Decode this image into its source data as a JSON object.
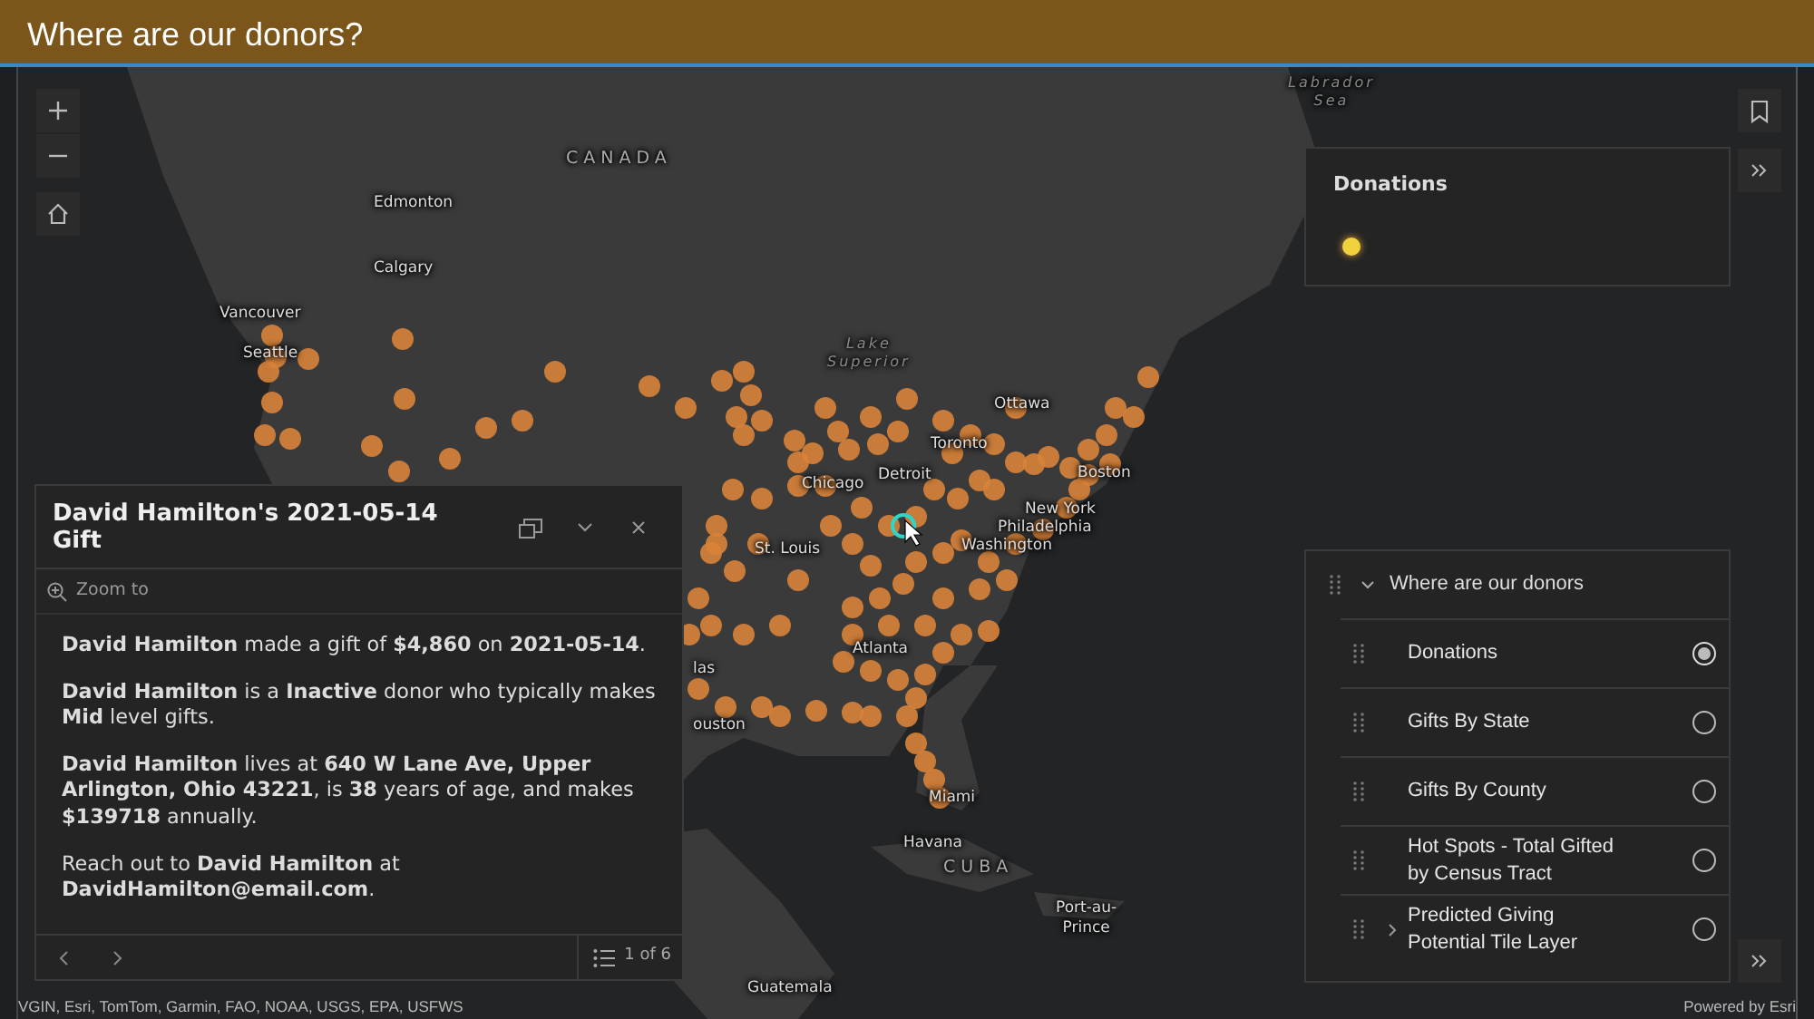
{
  "header": {
    "title": "Where are our donors?"
  },
  "map": {
    "labels": [
      {
        "text": "CANADA",
        "kind": "country"
      },
      {
        "text": "Edmonton",
        "kind": "city"
      },
      {
        "text": "Calgary",
        "kind": "city"
      },
      {
        "text": "Vancouver",
        "kind": "city"
      },
      {
        "text": "Seattle",
        "kind": "city"
      },
      {
        "text": "Lake\nSuperior",
        "kind": "water"
      },
      {
        "text": "Labrador\nSea",
        "kind": "water"
      },
      {
        "text": "Ottawa",
        "kind": "city"
      },
      {
        "text": "Toronto",
        "kind": "city"
      },
      {
        "text": "Chicago",
        "kind": "city"
      },
      {
        "text": "Detroit",
        "kind": "city"
      },
      {
        "text": "Boston",
        "kind": "city"
      },
      {
        "text": "New York",
        "kind": "city"
      },
      {
        "text": "Philadelphia",
        "kind": "city"
      },
      {
        "text": "St. Louis",
        "kind": "city"
      },
      {
        "text": "Washington",
        "kind": "city"
      },
      {
        "text": "las",
        "kind": "city"
      },
      {
        "text": "Atlanta",
        "kind": "city"
      },
      {
        "text": "ouston",
        "kind": "city"
      },
      {
        "text": "Miami",
        "kind": "city"
      },
      {
        "text": "Havana",
        "kind": "city"
      },
      {
        "text": "CUBA",
        "kind": "country"
      },
      {
        "text": "Port-au-\nPrince",
        "kind": "city"
      },
      {
        "text": "Guatemala",
        "kind": "city"
      }
    ],
    "attribution": "VGIN, Esri, TomTom, Garmin, FAO, NOAA, USGS, EPA, USFWS",
    "powered_by": "Powered by Esri"
  },
  "popup": {
    "title": "David Hamilton's 2021-05-14 Gift",
    "action": "Zoom to",
    "paragraphs": [
      "**David Hamilton** made a gift of **$4,860** on **2021-05-14**.",
      "**David Hamilton** is a **Inactive** donor who typically makes **Mid** level gifts.",
      "**David Hamilton** lives at **640 W Lane Ave, Upper Arlington, Ohio 43221**, is **38** years of age, and makes **$139718** annually.",
      "Reach out to **David Hamilton** at **DavidHamilton@email.com**."
    ],
    "pagination": "1 of 6"
  },
  "legend": {
    "title": "Donations"
  },
  "layer_list": {
    "title": "Where are our donors",
    "expanded": true,
    "items": [
      {
        "label": "Donations",
        "kind": "layer",
        "selected": true
      },
      {
        "label": "Gifts By State",
        "kind": "layer",
        "selected": false
      },
      {
        "label": "Gifts By County",
        "kind": "layer",
        "selected": false
      },
      {
        "label": "Hot Spots - Total Gifted by Census Tract",
        "kind": "layer",
        "selected": false
      },
      {
        "label": "Predicted Giving Potential Tile Layer",
        "kind": "group",
        "selected": false,
        "expanded": false
      }
    ]
  }
}
